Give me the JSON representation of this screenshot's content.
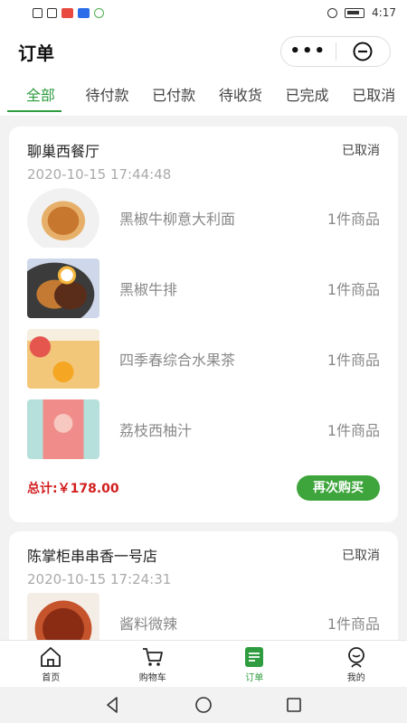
{
  "status_bar": {
    "time": "4:17"
  },
  "header": {
    "title": "订单"
  },
  "tabs": [
    "全部",
    "待付款",
    "已付款",
    "待收货",
    "已完成",
    "已取消"
  ],
  "orders": [
    {
      "shop": "聊巢西餐厅",
      "status": "已取消",
      "time": "2020-10-15 17:44:48",
      "items": [
        {
          "name": "黑椒牛柳意大利面",
          "count": "1件商品",
          "thumb": "pasta"
        },
        {
          "name": "黑椒牛排",
          "count": "1件商品",
          "thumb": "steak"
        },
        {
          "name": "四季春综合水果茶",
          "count": "1件商品",
          "thumb": "fruit-tea"
        },
        {
          "name": "荔枝西柚汁",
          "count": "1件商品",
          "thumb": "grapefruit-juice"
        }
      ],
      "total": "总计:￥178.00",
      "action": "再次购买"
    },
    {
      "shop": "陈掌柜串串香一号店",
      "status": "已取消",
      "time": "2020-10-15 17:24:31",
      "items": [
        {
          "name": "酱料微辣",
          "count": "1件商品",
          "thumb": "sauce"
        }
      ]
    }
  ],
  "bottom_nav": [
    {
      "label": "首页",
      "icon": "home-icon"
    },
    {
      "label": "购物车",
      "icon": "cart-icon"
    },
    {
      "label": "订单",
      "icon": "order-icon",
      "active": true
    },
    {
      "label": "我的",
      "icon": "profile-icon"
    }
  ],
  "colors": {
    "accent": "#2e9c3f",
    "button": "#3ea53c",
    "total": "#d21f1f"
  }
}
